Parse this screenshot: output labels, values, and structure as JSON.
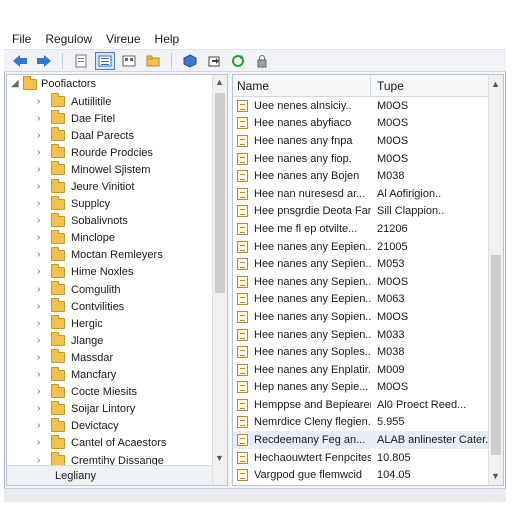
{
  "menu": [
    "File",
    "Regulow",
    "Vireue",
    "Help"
  ],
  "toolbar": {
    "buttons": [
      "back-icon",
      "forward-icon",
      "page-icon",
      "details-view-icon",
      "tiles-icon",
      "folder-up-icon",
      "cube-icon",
      "share-icon",
      "refresh-icon",
      "lock-icon"
    ]
  },
  "tree": {
    "root": "Poofiactors",
    "items": [
      "Autiilitile",
      "Dae Fitel",
      "Daal Parects",
      "Rourde Prodcies",
      "Minowel Sjistem",
      "Jeure Vinitiot",
      "Supplcy",
      "Sobalivnots",
      "Minclope",
      "Moctan Remleyers",
      "Hime Noxles",
      "Comgulith",
      "Contvilities",
      "Hergic",
      "Jlange",
      "Massdar",
      "Mancfary",
      "Cocte Miesits",
      "Soijar Lintory",
      "Devictacy",
      "Cantel of Acaestors",
      "Cremtihy Dissange"
    ],
    "footer": "Legliany"
  },
  "list": {
    "columns": {
      "name": "Name",
      "type": "Tupe"
    },
    "rows": [
      {
        "name": "Uee nenes alnsiciy..",
        "type": "M0OS"
      },
      {
        "name": "Hee nanes abyfiaco",
        "type": "M0OS"
      },
      {
        "name": "Hee nanes any fnpa",
        "type": "M0OS"
      },
      {
        "name": "Hee nanes any fiop.",
        "type": "M0OS"
      },
      {
        "name": "Hee nanes any Bojen",
        "type": "M038"
      },
      {
        "name": "Hee nan nuresesd ar...",
        "type": "Al Aofirigion.."
      },
      {
        "name": "Hee pnsgrdie Deota Fan",
        "type": "Sill Clappion.."
      },
      {
        "name": "Hee me fl ep otvilte...",
        "type": "21206"
      },
      {
        "name": "Hee nanes any Eepien...",
        "type": "21005"
      },
      {
        "name": "Hee nanes any Sepien..",
        "type": "M053"
      },
      {
        "name": "Hee nanes any Sepien..",
        "type": "M0OS"
      },
      {
        "name": "Hee nanes any Eepien...",
        "type": "M063"
      },
      {
        "name": "Hee nanes any Sopien...",
        "type": "M0OS"
      },
      {
        "name": "Hee nanes any Sepien..",
        "type": "M033"
      },
      {
        "name": "Hee nanes any Soples...",
        "type": "M038"
      },
      {
        "name": "Hee nanes any Enplatir...",
        "type": "M009"
      },
      {
        "name": "Hep nanes any Sepie...",
        "type": "M0OS"
      },
      {
        "name": "Hemppse and Bepiearer...",
        "type": "Al0 Proect Reed..."
      },
      {
        "name": "Nemrdice Cleny flegien..",
        "type": "5.955"
      },
      {
        "name": "Recdeemany Feg an...",
        "type": "ALAB anlinester Cater.."
      },
      {
        "name": "Hechaouwtert Fenpcites",
        "type": "10.805"
      },
      {
        "name": "Vargpod gue flemwcid",
        "type": "104.05"
      }
    ],
    "selected_index": 19
  }
}
